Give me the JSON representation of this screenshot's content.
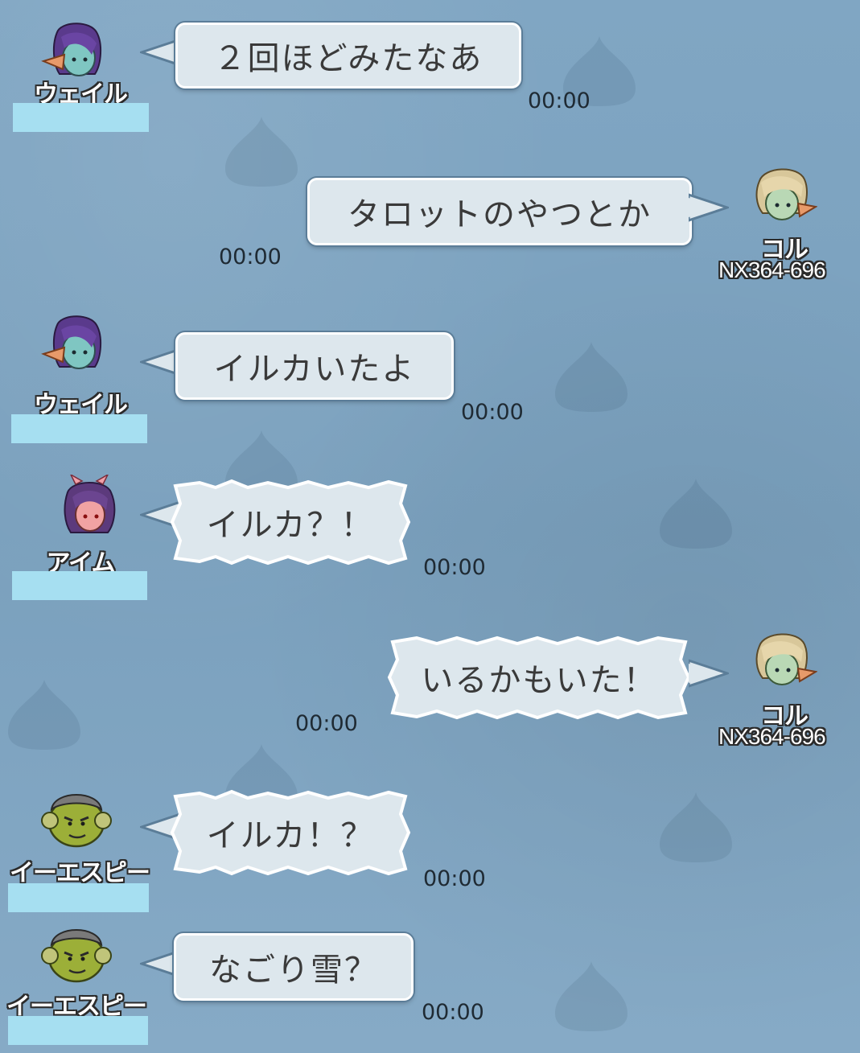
{
  "colors": {
    "background": "#7da2bf",
    "bubble_fill": "#dde7ed",
    "bubble_border": "#ffffff",
    "name_mask": "#a6dff1"
  },
  "messages": [
    {
      "sender": "ウェイル",
      "text": "２回ほどみたなあ",
      "time": "00:00",
      "side": "left",
      "style": "normal",
      "avatar": "purple-hair-elf-avatar"
    },
    {
      "sender": "コル",
      "code": "NX364-696",
      "text": "タロットのやつとか",
      "time": "00:00",
      "side": "right",
      "style": "normal",
      "avatar": "blonde-elf-avatar"
    },
    {
      "sender": "ウェイル",
      "text": "イルカいたよ",
      "time": "00:00",
      "side": "left",
      "style": "normal",
      "avatar": "purple-hair-elf-avatar"
    },
    {
      "sender": "アイム",
      "text": "イルカ？！",
      "time": "00:00",
      "side": "left",
      "style": "spiky",
      "avatar": "horned-girl-avatar"
    },
    {
      "sender": "コル",
      "code": "NX364-696",
      "text": "いるかもいた！",
      "time": "00:00",
      "side": "right",
      "style": "spiky",
      "avatar": "blonde-elf-avatar"
    },
    {
      "sender": "イーエスピー",
      "text": "イルカ！？",
      "time": "00:00",
      "side": "left",
      "style": "spiky",
      "avatar": "green-ogre-avatar"
    },
    {
      "sender": "イーエスピー",
      "text": "なごり雪？",
      "time": "00:00",
      "side": "left",
      "style": "normal",
      "avatar": "green-ogre-avatar"
    }
  ]
}
